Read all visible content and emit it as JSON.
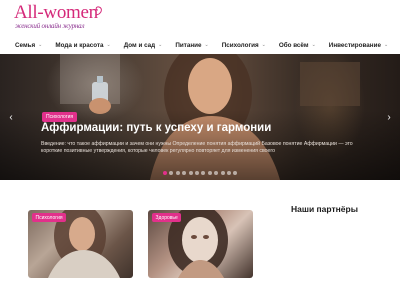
{
  "logo": {
    "main": "All-women",
    "sub": "женский онлайн журнал"
  },
  "nav": {
    "items": [
      {
        "label": "Семья",
        "icon": "chevron-down-icon"
      },
      {
        "label": "Мода и красота",
        "icon": "chevron-down-icon"
      },
      {
        "label": "Дом и сад",
        "icon": "chevron-down-icon"
      },
      {
        "label": "Питание",
        "icon": "chevron-down-icon"
      },
      {
        "label": "Психология",
        "icon": "chevron-down-icon"
      },
      {
        "label": "Обо всём",
        "icon": "chevron-down-icon"
      },
      {
        "label": "Инвестирование",
        "icon": "chevron-down-icon"
      }
    ],
    "caret": "⌄"
  },
  "hero": {
    "badge": "Психология",
    "title": "Аффирмации: путь к успеху и гармонии",
    "excerpt": "Введение: что такое аффирмации и зачем они нужны Определение понятия аффирмаций Базовое понятие Аффирмации — это короткие позитивные утверждения, которые человек регулярно повторяет для изменения своего",
    "prev_arrow": "‹",
    "next_arrow": "›",
    "slide_count": 12,
    "active_slide": 1
  },
  "cards": [
    {
      "badge": "Психология"
    },
    {
      "badge": "Здоровье"
    }
  ],
  "sidebar": {
    "title": "Наши партнёры"
  },
  "colors": {
    "accent": "#e2308b",
    "logo": "#d52a7a"
  }
}
